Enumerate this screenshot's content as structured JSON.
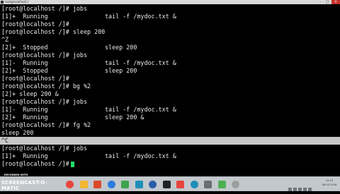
{
  "window": {
    "title": "root@localhost:/",
    "minimize": "–",
    "maximize": "□",
    "close": "✕"
  },
  "terminal": {
    "lines": [
      {
        "text": "[root@localhost /]# jobs",
        "tail": ""
      },
      {
        "text": "[1]+  Running",
        "tail": "tail -f /mydoc.txt &"
      },
      {
        "text": "[root@localhost /]#",
        "tail": ""
      },
      {
        "text": "[root@localhost /]# sleep 200",
        "tail": ""
      },
      {
        "text": "^Z",
        "tail": ""
      },
      {
        "text": "[2]+  Stopped",
        "tail": "sleep 200"
      },
      {
        "text": "[root@localhost /]# jobs",
        "tail": ""
      },
      {
        "text": "[1]-  Running",
        "tail": "tail -f /mydoc.txt &"
      },
      {
        "text": "[2]+  Stopped",
        "tail": "sleep 200"
      },
      {
        "text": "[root@localhost /]#",
        "tail": ""
      },
      {
        "text": "[root@localhost /]# bg %2",
        "tail": ""
      },
      {
        "text": "[2]+ sleep 200 &",
        "tail": ""
      },
      {
        "text": "[root@localhost /]# jobs",
        "tail": ""
      },
      {
        "text": "[1]-  Running",
        "tail": "tail -f /mydoc.txt &"
      },
      {
        "text": "[2]+  Running",
        "tail": "sleep 200 &"
      },
      {
        "text": "[root@localhost /]# fg %2",
        "tail": ""
      },
      {
        "text": "sleep 200",
        "tail": ""
      },
      {
        "text": "^C",
        "tail": ""
      },
      {
        "text": "[root@localhost /]# jobs",
        "tail": ""
      },
      {
        "text": "[1]+  Running",
        "tail": "tail -f /mydoc.txt &"
      },
      {
        "text": "[root@localhost /]#",
        "tail": ""
      }
    ],
    "highlighted_line": 17,
    "cursor_color": "#22e06a"
  },
  "taskbar": {
    "watermark_line1": "RECORDED WITH",
    "watermark_line2": "SCREENCAST-O-MATIC",
    "icons": [
      {
        "name": "chrome-icon",
        "color": "#e8453c"
      },
      {
        "name": "file-manager-icon",
        "color": "#f2b632"
      },
      {
        "name": "media-player-icon",
        "color": "#d94b2b"
      },
      {
        "name": "browser-icon",
        "color": "#2b7de0"
      },
      {
        "name": "app-icon",
        "color": "#3fa34d"
      },
      {
        "name": "network-icon",
        "color": "#1f8fb8"
      },
      {
        "name": "word-icon",
        "color": "#2a5caa"
      },
      {
        "name": "terminal-icon",
        "color": "#222222"
      },
      {
        "name": "chrome-icon-2",
        "color": "#e8453c"
      },
      {
        "name": "network-icon-2",
        "color": "#1f8fb8"
      },
      {
        "name": "settings-icon",
        "color": "#6b6f74"
      },
      {
        "name": "chrome-icon-3",
        "color": "#4caf50"
      },
      {
        "name": "app-icon-2",
        "color": "#9e9e9e"
      }
    ],
    "clock_time": "12:15",
    "clock_date": "08-02-2016"
  }
}
